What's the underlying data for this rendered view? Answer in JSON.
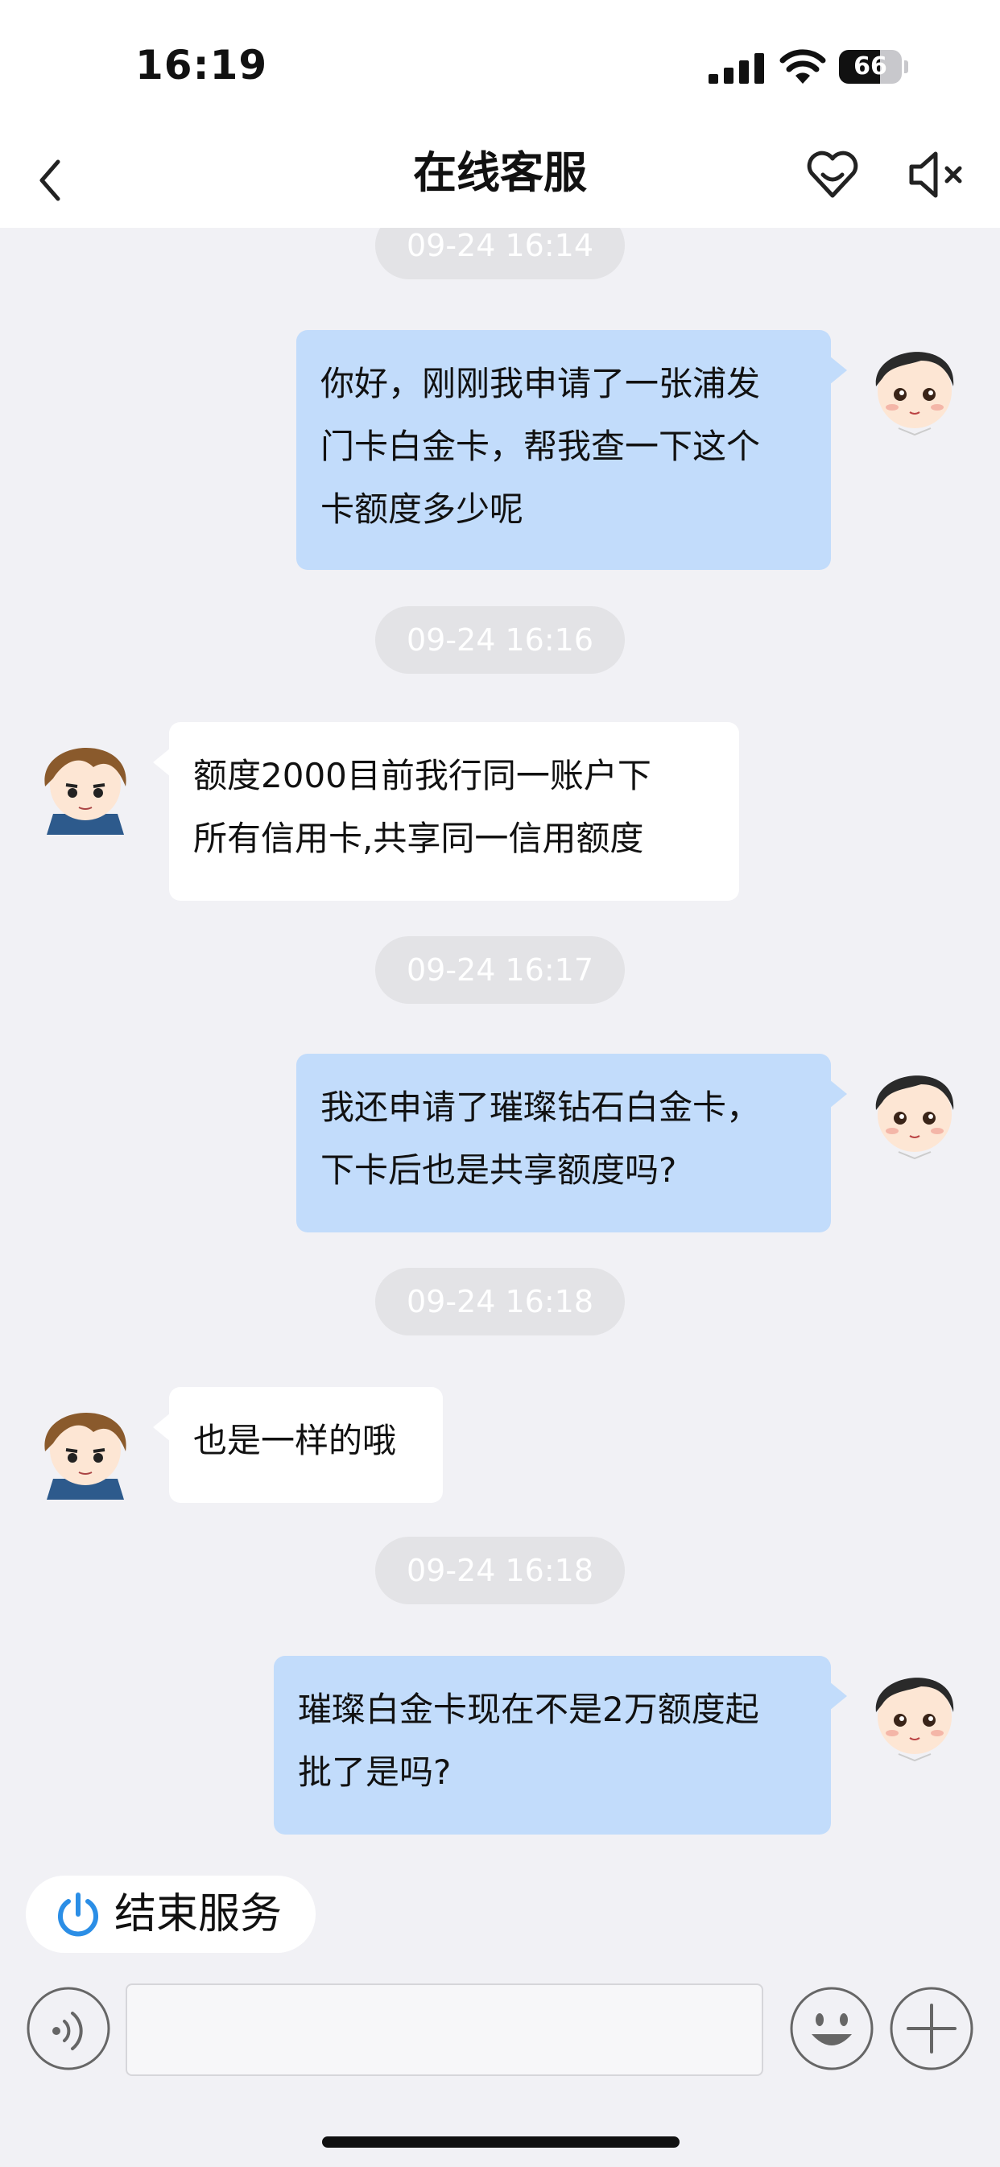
{
  "status_bar": {
    "time": "16:19",
    "battery_level": "66",
    "icons": [
      "signal-icon",
      "wifi-icon",
      "battery-icon"
    ]
  },
  "nav": {
    "title": "在线客服",
    "icons": [
      "back-icon",
      "heart-icon",
      "mute-icon"
    ]
  },
  "messages": [
    {
      "type": "timestamp",
      "text": "09-24 16:14"
    },
    {
      "type": "message",
      "side": "right",
      "sender": "user",
      "text": "你好，刚刚我申请了一张浦发\n门卡白金卡，帮我查一下这个\n卡额度多少呢"
    },
    {
      "type": "timestamp",
      "text": "09-24 16:16"
    },
    {
      "type": "message",
      "side": "left",
      "sender": "agent",
      "text": "额度2000目前我行同一账户下\n所有信用卡,共享同一信用额度"
    },
    {
      "type": "timestamp",
      "text": "09-24 16:17"
    },
    {
      "type": "message",
      "side": "right",
      "sender": "user",
      "text": "我还申请了璀璨钻石白金卡，\n下卡后也是共享额度吗?"
    },
    {
      "type": "timestamp",
      "text": "09-24 16:18"
    },
    {
      "type": "message",
      "side": "left",
      "sender": "agent",
      "text": "也是一样的哦"
    },
    {
      "type": "timestamp",
      "text": "09-24 16:18"
    },
    {
      "type": "message",
      "side": "right",
      "sender": "user",
      "text": "璀璨白金卡现在不是2万额度起\n批了是吗?"
    }
  ],
  "bottom": {
    "end_service_label": "结束服务",
    "input_value": "",
    "icons": [
      "power-icon",
      "voice-icon",
      "emoji-icon",
      "plus-icon"
    ]
  },
  "colors": {
    "user_bubble": "#c2dcfb",
    "agent_bubble": "#ffffff",
    "background": "#f1f1f5",
    "accent": "#2b8ee6"
  }
}
